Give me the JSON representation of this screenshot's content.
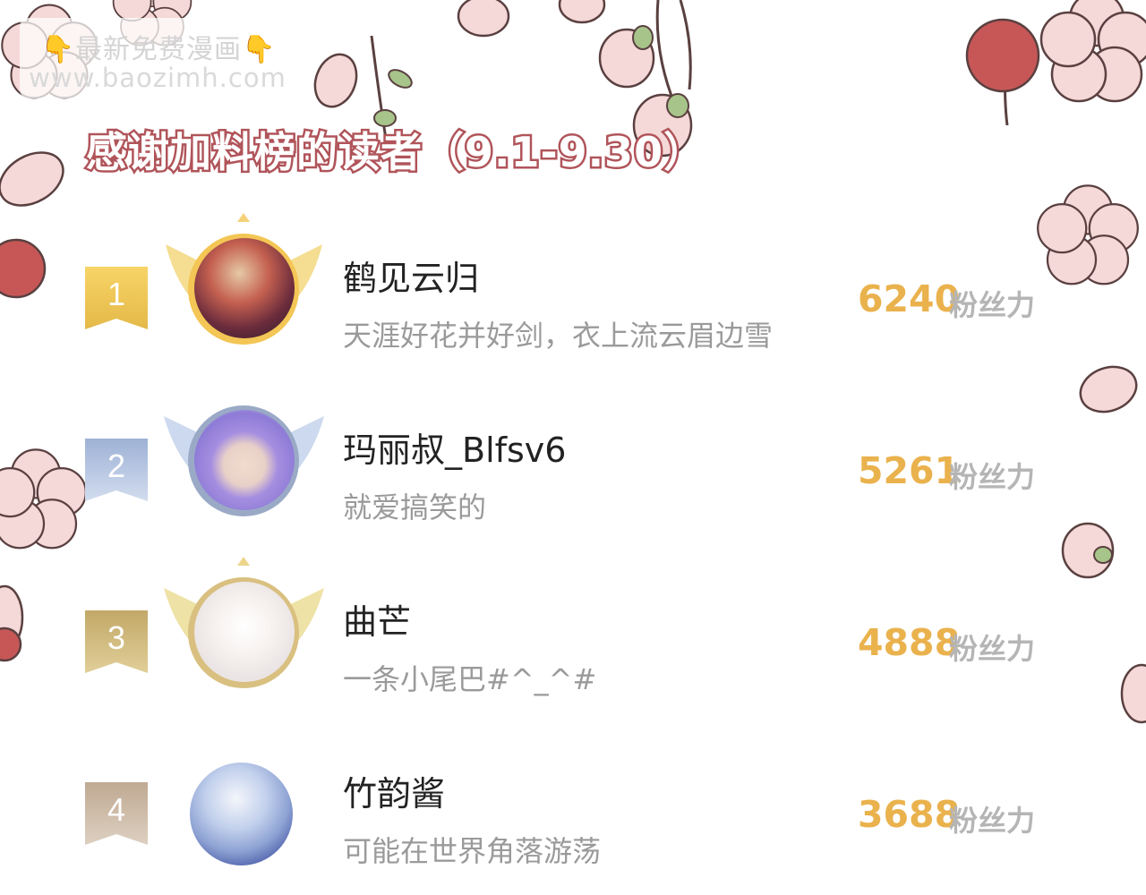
{
  "watermark": {
    "line1": "最新免费漫画",
    "line2": "www.baozimh.com",
    "hand_icon": "👇"
  },
  "title": "感谢加料榜的读者（9.1-9.30）",
  "colors": {
    "title_stroke": "#b0545a",
    "score": "#eab24d",
    "gold": "#f0c550",
    "silver": "#a9bcdc",
    "bronze": "#cdb57c",
    "rank4": "#c5b19c",
    "petal": "#f5d9d8",
    "cherry": "#c75757"
  },
  "entries": [
    {
      "rank": "1",
      "name": "鹤见云归",
      "motto": "天涯好花并好剑，衣上流云眉边雪",
      "score": "6240",
      "unit": "粉丝力"
    },
    {
      "rank": "2",
      "name": "玛丽叔_Blfsv6",
      "motto": "就爱搞笑的",
      "score": "5261",
      "unit": "粉丝力"
    },
    {
      "rank": "3",
      "name": "曲芒",
      "motto": "一条小尾巴#^_^#",
      "score": "4888",
      "unit": "粉丝力"
    },
    {
      "rank": "4",
      "name": "竹韵酱",
      "motto": "可能在世界角落游荡",
      "score": "3688",
      "unit": "粉丝力"
    }
  ]
}
